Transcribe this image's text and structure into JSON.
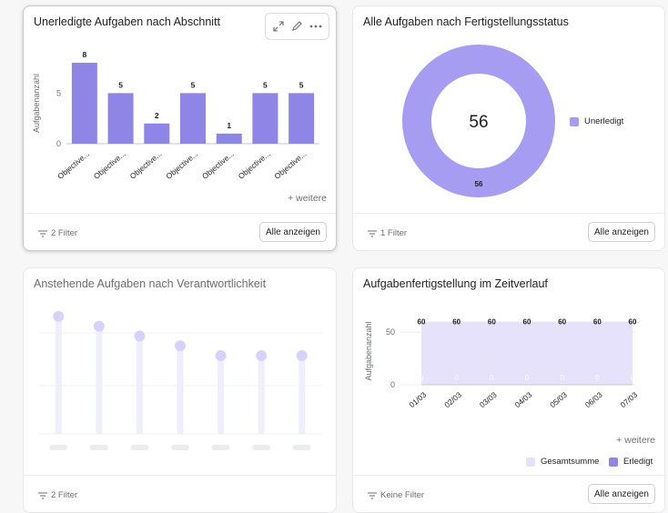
{
  "colors": {
    "bar": "#8f85e6",
    "ring": "#a69cf2",
    "lollipop": "#d6d2fb",
    "lollipopStem": "#efeefd",
    "total": "#e6e2fb"
  },
  "card1": {
    "title": "Unerledigte Aufgaben nach Abschnitt",
    "more": "+ weitere",
    "filter": "2 Filter",
    "button": "Alle anzeigen",
    "toolbar_icons": [
      "expand-icon",
      "pencil-icon",
      "more-icon"
    ]
  },
  "card2": {
    "title": "Alle Aufgaben nach Fertigstellungsstatus",
    "center_value": "56",
    "filter": "1 Filter",
    "button": "Alle anzeigen"
  },
  "card3": {
    "title": "Anstehende Aufgaben nach Verantwortlichkeit",
    "filter": "2 Filter"
  },
  "card4": {
    "title": "Aufgabenfertigstellung im Zeitverlauf",
    "more": "+ weitere",
    "filter": "Keine Filter",
    "button": "Alle anzeigen"
  },
  "chart_data": [
    {
      "type": "bar",
      "ylabel": "Aufgabenanzahl",
      "yticks": [
        0,
        5
      ],
      "ylim": [
        0,
        8
      ],
      "categories": [
        "Objective...",
        "Objective...",
        "Objective...",
        "Objective...",
        "Objective...",
        "Objective...",
        "Objective..."
      ],
      "values": [
        8,
        5,
        2,
        5,
        1,
        5,
        5
      ]
    },
    {
      "type": "pie",
      "series": [
        {
          "name": "Unerledigt",
          "values": [
            56
          ]
        }
      ],
      "labels": [
        "56"
      ]
    },
    {
      "type": "scatter",
      "values": [
        60,
        55,
        50,
        45,
        40,
        40,
        40
      ]
    },
    {
      "type": "area",
      "ylabel": "Aufgabenanzahl",
      "yticks": [
        0,
        50
      ],
      "ylim": [
        0,
        70
      ],
      "categories": [
        "01/03",
        "02/03",
        "03/03",
        "04/03",
        "05/03",
        "06/03",
        "07/03"
      ],
      "series": [
        {
          "name": "Gesamtsumme",
          "values": [
            60,
            60,
            60,
            60,
            60,
            60,
            60
          ]
        },
        {
          "name": "Erledigt",
          "values": [
            0,
            0,
            0,
            0,
            0,
            0,
            0
          ]
        }
      ]
    }
  ]
}
